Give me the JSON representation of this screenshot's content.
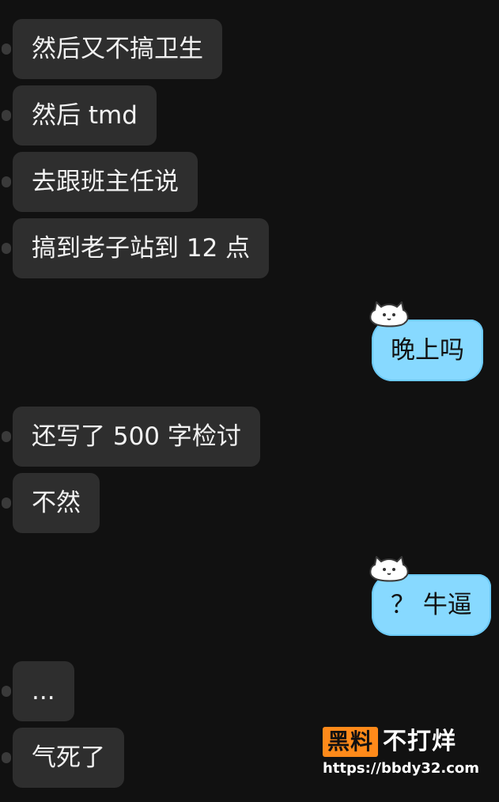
{
  "messages": [
    {
      "side": "incoming",
      "text": "然后又不搞卫生"
    },
    {
      "side": "incoming",
      "text": "然后 tmd"
    },
    {
      "side": "incoming",
      "text": "去跟班主任说"
    },
    {
      "side": "incoming",
      "text": "搞到老子站到 12 点"
    },
    {
      "side": "outgoing",
      "text": "晚上吗",
      "decoration": "cat-mascot-icon"
    },
    {
      "side": "incoming",
      "text": "还写了 500 字检讨"
    },
    {
      "side": "incoming",
      "text": "不然"
    },
    {
      "side": "outgoing",
      "text": "？ 牛逼",
      "decoration": "cat-mascot-icon"
    },
    {
      "side": "incoming",
      "text": "..."
    },
    {
      "side": "incoming",
      "text": "气死了"
    }
  ],
  "watermark": {
    "badge": "黑料",
    "title": "不打烊",
    "url": "https://bbdy32.com"
  },
  "colors": {
    "background": "#111111",
    "incoming_bubble": "#2e2e2e",
    "outgoing_bubble": "#87d9ff",
    "watermark_accent": "#ff8a1a"
  }
}
